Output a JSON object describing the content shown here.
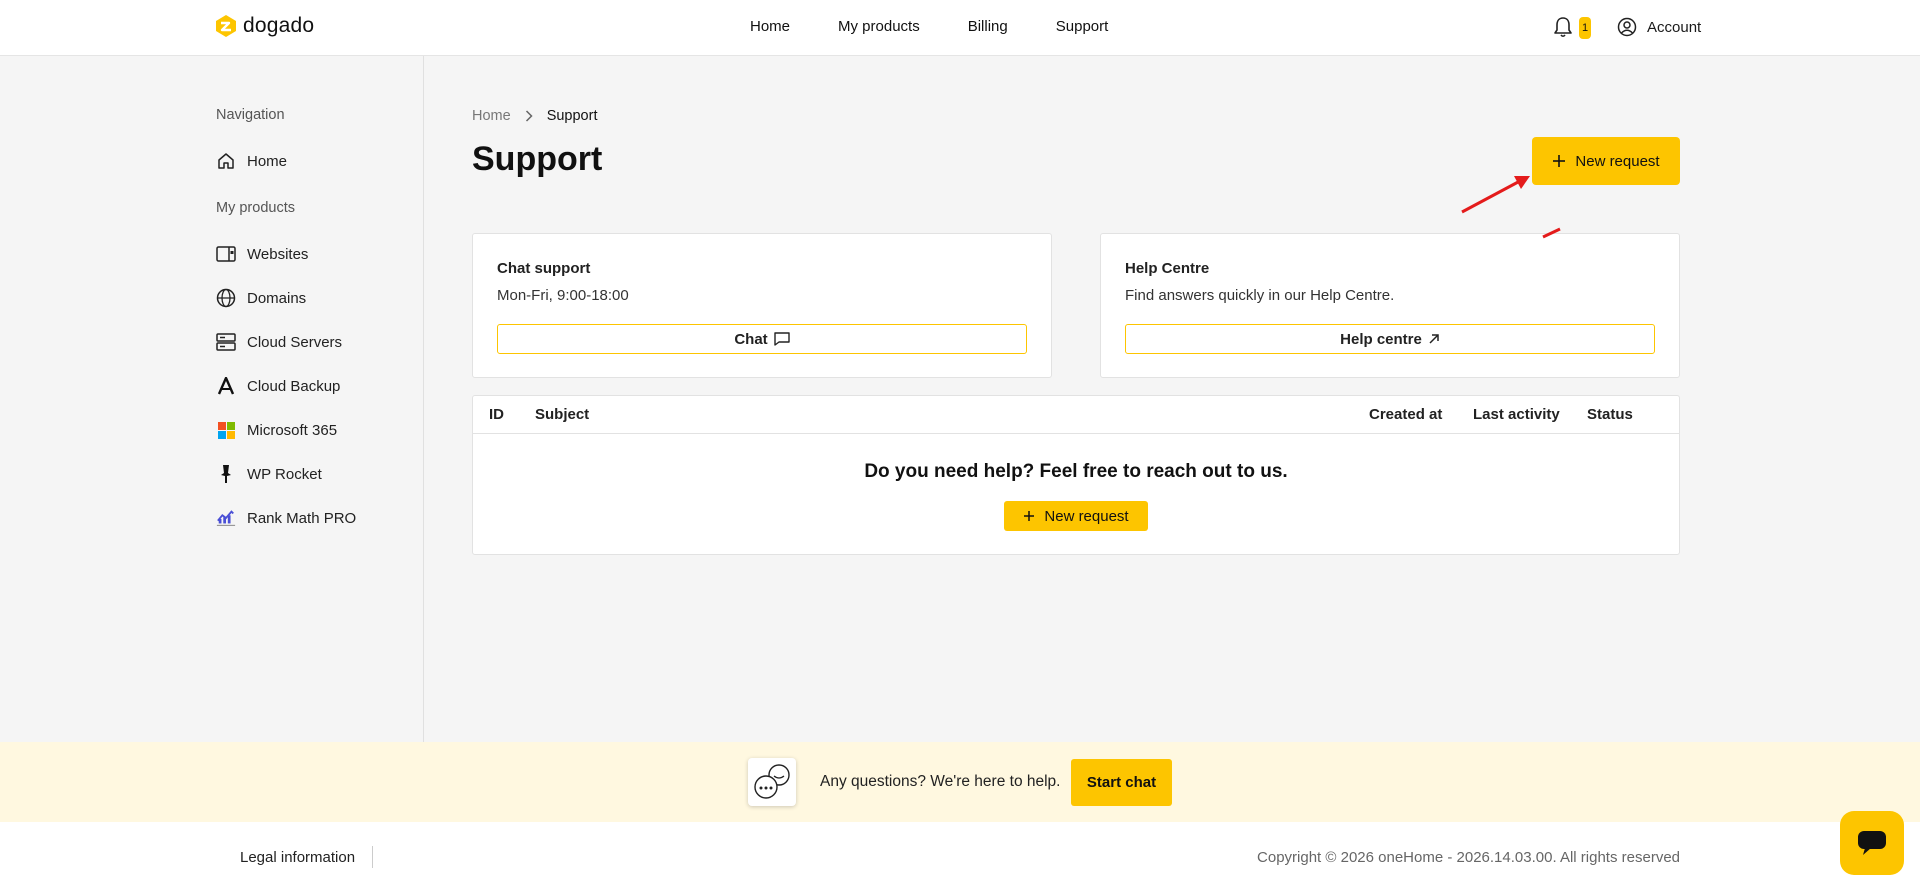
{
  "brand": {
    "name": "dogado",
    "accent": "#fdc500"
  },
  "topnav": {
    "items": [
      "Home",
      "My products",
      "Billing",
      "Support"
    ]
  },
  "header": {
    "notification_count": "1",
    "account_label": "Account"
  },
  "sidebar": {
    "nav_heading": "Navigation",
    "home_label": "Home",
    "products_heading": "My products",
    "products": [
      {
        "label": "Websites",
        "icon": "website-icon"
      },
      {
        "label": "Domains",
        "icon": "globe-icon"
      },
      {
        "label": "Cloud Servers",
        "icon": "server-icon"
      },
      {
        "label": "Cloud Backup",
        "icon": "backup-icon"
      },
      {
        "label": "Microsoft 365",
        "icon": "microsoft-icon"
      },
      {
        "label": "WP Rocket",
        "icon": "rocket-icon"
      },
      {
        "label": "Rank Math PRO",
        "icon": "rankmath-icon"
      }
    ]
  },
  "breadcrumb": {
    "home": "Home",
    "current": "Support"
  },
  "page": {
    "title": "Support",
    "new_request_label": "New request"
  },
  "chat_card": {
    "title": "Chat support",
    "subtitle": "Mon-Fri, 9:00-18:00",
    "button_label": "Chat"
  },
  "help_card": {
    "title": "Help Centre",
    "subtitle": "Find answers quickly in our Help Centre.",
    "button_label": "Help centre"
  },
  "table": {
    "columns": [
      "ID",
      "Subject",
      "Created at",
      "Last activity",
      "Status"
    ],
    "empty_message": "Do you need help? Feel free to reach out to us.",
    "empty_button_label": "New request"
  },
  "chat_banner": {
    "text": "Any questions? We're here to help.",
    "button_label": "Start chat"
  },
  "footer": {
    "legal_label": "Legal information",
    "copyright": "Copyright © 2026 oneHome - 2026.14.03.00. All rights reserved"
  }
}
